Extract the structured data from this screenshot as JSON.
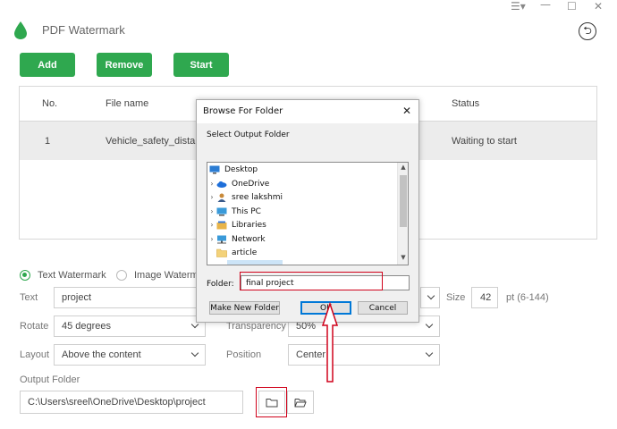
{
  "window": {
    "controls": [
      "☰▾",
      "—",
      "☐",
      "✕"
    ]
  },
  "header": {
    "title": "PDF Watermark",
    "back_icon": "⮌"
  },
  "toolbar": {
    "add_label": "Add",
    "remove_label": "Remove",
    "start_label": "Start",
    "accent": "#2fa84f"
  },
  "table": {
    "columns": [
      "No.",
      "File name",
      "Status"
    ],
    "rows": [
      {
        "no": "1",
        "file": "Vehicle_safety_distanc",
        "status": "Waiting to start"
      }
    ]
  },
  "settings": {
    "text_watermark": "Text Watermark",
    "image_watermark": "Image Waterma",
    "text_label": "Text",
    "text_value": "project",
    "size_label": "Size",
    "size_value": "42",
    "size_range": "pt (6-144)",
    "rotate_label": "Rotate",
    "rotate_value": "45 degrees",
    "transparency_label": "Transparency",
    "transparency_value": "50%",
    "layout_label": "Layout",
    "layout_value": "Above the content",
    "position_label": "Position",
    "position_value": "Center",
    "output_label": "Output Folder",
    "output_value": "C:\\Users\\sreel\\OneDrive\\Desktop\\project"
  },
  "dialog": {
    "title": "Browse For Folder",
    "close": "✕",
    "subtitle": "Select Output Folder",
    "tree": [
      {
        "label": "Desktop",
        "icon": "desktop-icon",
        "arrow": ""
      },
      {
        "label": "OneDrive",
        "icon": "cloud-icon",
        "arrow": "›"
      },
      {
        "label": "sree lakshmi",
        "icon": "user-icon",
        "arrow": "›"
      },
      {
        "label": "This PC",
        "icon": "computer-icon",
        "arrow": "›"
      },
      {
        "label": "Libraries",
        "icon": "libraries-icon",
        "arrow": "›"
      },
      {
        "label": "Network",
        "icon": "network-icon",
        "arrow": "›"
      },
      {
        "label": "article",
        "icon": "folder-icon",
        "arrow": ""
      }
    ],
    "folder_label": "Folder:",
    "folder_value": "final project",
    "make_new_folder": "Make New Folder",
    "ok": "OK",
    "cancel": "Cancel"
  },
  "annotation_color": "#d0021b"
}
